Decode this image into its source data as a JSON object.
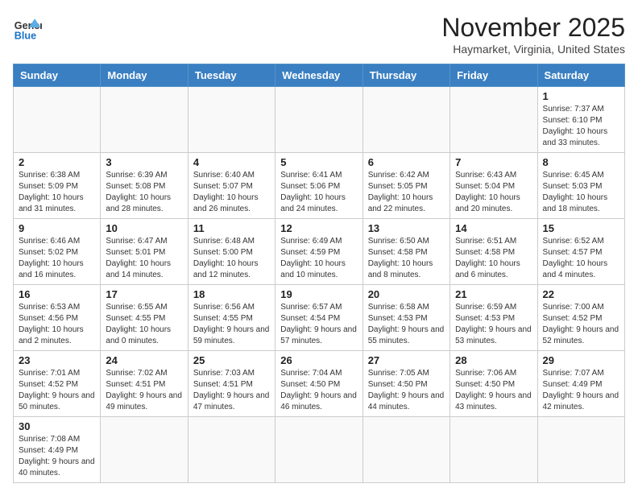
{
  "header": {
    "logo_general": "General",
    "logo_blue": "Blue",
    "month_year": "November 2025",
    "location": "Haymarket, Virginia, United States"
  },
  "weekdays": [
    "Sunday",
    "Monday",
    "Tuesday",
    "Wednesday",
    "Thursday",
    "Friday",
    "Saturday"
  ],
  "weeks": [
    [
      {
        "day": "",
        "info": ""
      },
      {
        "day": "",
        "info": ""
      },
      {
        "day": "",
        "info": ""
      },
      {
        "day": "",
        "info": ""
      },
      {
        "day": "",
        "info": ""
      },
      {
        "day": "",
        "info": ""
      },
      {
        "day": "1",
        "info": "Sunrise: 7:37 AM\nSunset: 6:10 PM\nDaylight: 10 hours and 33 minutes."
      }
    ],
    [
      {
        "day": "2",
        "info": "Sunrise: 6:38 AM\nSunset: 5:09 PM\nDaylight: 10 hours and 31 minutes."
      },
      {
        "day": "3",
        "info": "Sunrise: 6:39 AM\nSunset: 5:08 PM\nDaylight: 10 hours and 28 minutes."
      },
      {
        "day": "4",
        "info": "Sunrise: 6:40 AM\nSunset: 5:07 PM\nDaylight: 10 hours and 26 minutes."
      },
      {
        "day": "5",
        "info": "Sunrise: 6:41 AM\nSunset: 5:06 PM\nDaylight: 10 hours and 24 minutes."
      },
      {
        "day": "6",
        "info": "Sunrise: 6:42 AM\nSunset: 5:05 PM\nDaylight: 10 hours and 22 minutes."
      },
      {
        "day": "7",
        "info": "Sunrise: 6:43 AM\nSunset: 5:04 PM\nDaylight: 10 hours and 20 minutes."
      },
      {
        "day": "8",
        "info": "Sunrise: 6:45 AM\nSunset: 5:03 PM\nDaylight: 10 hours and 18 minutes."
      }
    ],
    [
      {
        "day": "9",
        "info": "Sunrise: 6:46 AM\nSunset: 5:02 PM\nDaylight: 10 hours and 16 minutes."
      },
      {
        "day": "10",
        "info": "Sunrise: 6:47 AM\nSunset: 5:01 PM\nDaylight: 10 hours and 14 minutes."
      },
      {
        "day": "11",
        "info": "Sunrise: 6:48 AM\nSunset: 5:00 PM\nDaylight: 10 hours and 12 minutes."
      },
      {
        "day": "12",
        "info": "Sunrise: 6:49 AM\nSunset: 4:59 PM\nDaylight: 10 hours and 10 minutes."
      },
      {
        "day": "13",
        "info": "Sunrise: 6:50 AM\nSunset: 4:58 PM\nDaylight: 10 hours and 8 minutes."
      },
      {
        "day": "14",
        "info": "Sunrise: 6:51 AM\nSunset: 4:58 PM\nDaylight: 10 hours and 6 minutes."
      },
      {
        "day": "15",
        "info": "Sunrise: 6:52 AM\nSunset: 4:57 PM\nDaylight: 10 hours and 4 minutes."
      }
    ],
    [
      {
        "day": "16",
        "info": "Sunrise: 6:53 AM\nSunset: 4:56 PM\nDaylight: 10 hours and 2 minutes."
      },
      {
        "day": "17",
        "info": "Sunrise: 6:55 AM\nSunset: 4:55 PM\nDaylight: 10 hours and 0 minutes."
      },
      {
        "day": "18",
        "info": "Sunrise: 6:56 AM\nSunset: 4:55 PM\nDaylight: 9 hours and 59 minutes."
      },
      {
        "day": "19",
        "info": "Sunrise: 6:57 AM\nSunset: 4:54 PM\nDaylight: 9 hours and 57 minutes."
      },
      {
        "day": "20",
        "info": "Sunrise: 6:58 AM\nSunset: 4:53 PM\nDaylight: 9 hours and 55 minutes."
      },
      {
        "day": "21",
        "info": "Sunrise: 6:59 AM\nSunset: 4:53 PM\nDaylight: 9 hours and 53 minutes."
      },
      {
        "day": "22",
        "info": "Sunrise: 7:00 AM\nSunset: 4:52 PM\nDaylight: 9 hours and 52 minutes."
      }
    ],
    [
      {
        "day": "23",
        "info": "Sunrise: 7:01 AM\nSunset: 4:52 PM\nDaylight: 9 hours and 50 minutes."
      },
      {
        "day": "24",
        "info": "Sunrise: 7:02 AM\nSunset: 4:51 PM\nDaylight: 9 hours and 49 minutes."
      },
      {
        "day": "25",
        "info": "Sunrise: 7:03 AM\nSunset: 4:51 PM\nDaylight: 9 hours and 47 minutes."
      },
      {
        "day": "26",
        "info": "Sunrise: 7:04 AM\nSunset: 4:50 PM\nDaylight: 9 hours and 46 minutes."
      },
      {
        "day": "27",
        "info": "Sunrise: 7:05 AM\nSunset: 4:50 PM\nDaylight: 9 hours and 44 minutes."
      },
      {
        "day": "28",
        "info": "Sunrise: 7:06 AM\nSunset: 4:50 PM\nDaylight: 9 hours and 43 minutes."
      },
      {
        "day": "29",
        "info": "Sunrise: 7:07 AM\nSunset: 4:49 PM\nDaylight: 9 hours and 42 minutes."
      }
    ],
    [
      {
        "day": "30",
        "info": "Sunrise: 7:08 AM\nSunset: 4:49 PM\nDaylight: 9 hours and 40 minutes."
      },
      {
        "day": "",
        "info": ""
      },
      {
        "day": "",
        "info": ""
      },
      {
        "day": "",
        "info": ""
      },
      {
        "day": "",
        "info": ""
      },
      {
        "day": "",
        "info": ""
      },
      {
        "day": "",
        "info": ""
      }
    ]
  ]
}
